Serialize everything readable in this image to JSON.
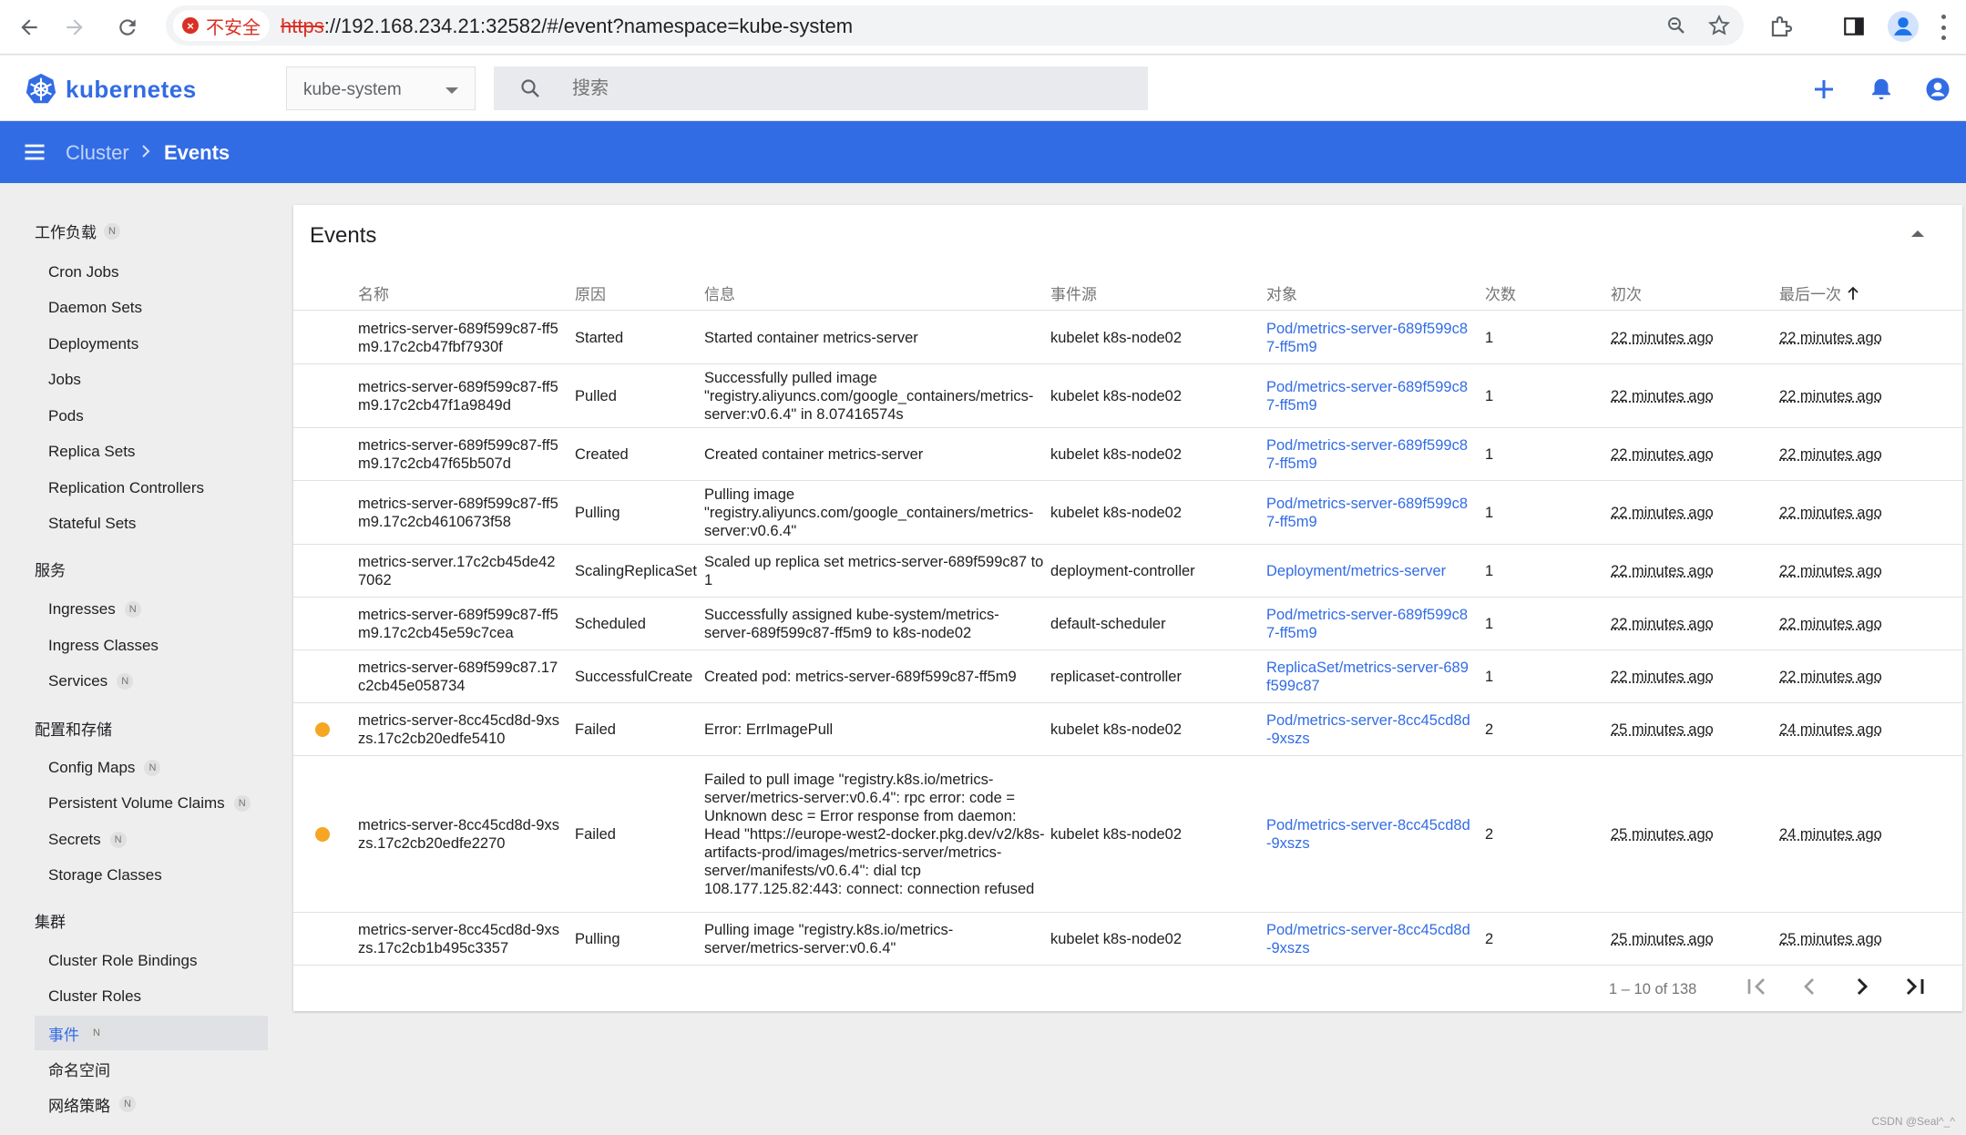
{
  "browser": {
    "security_label": "不安全",
    "url_protocol": "https",
    "url_rest": "://192.168.234.21:32582/#/event?namespace=kube-system"
  },
  "header": {
    "brand": "kubernetes",
    "namespace": "kube-system",
    "search_placeholder": "搜索"
  },
  "toolbar": {
    "crumb_parent": "Cluster",
    "crumb_current": "Events"
  },
  "sidebar": {
    "sections": [
      {
        "label": "工作负载",
        "badge": "N"
      },
      {
        "label": "服务"
      },
      {
        "label": "配置和存储"
      },
      {
        "label": "集群"
      }
    ],
    "items": [
      {
        "label": "Cron Jobs"
      },
      {
        "label": "Daemon Sets"
      },
      {
        "label": "Deployments"
      },
      {
        "label": "Jobs"
      },
      {
        "label": "Pods"
      },
      {
        "label": "Replica Sets"
      },
      {
        "label": "Replication Controllers"
      },
      {
        "label": "Stateful Sets"
      },
      {
        "label": "Ingresses",
        "badge": "N"
      },
      {
        "label": "Ingress Classes"
      },
      {
        "label": "Services",
        "badge": "N"
      },
      {
        "label": "Config Maps",
        "badge": "N"
      },
      {
        "label": "Persistent Volume Claims",
        "badge": "N"
      },
      {
        "label": "Secrets",
        "badge": "N"
      },
      {
        "label": "Storage Classes"
      },
      {
        "label": "Cluster Role Bindings"
      },
      {
        "label": "Cluster Roles"
      },
      {
        "label": "事件",
        "badge": "N",
        "active": true
      },
      {
        "label": "命名空间"
      },
      {
        "label": "网络策略",
        "badge": "N"
      }
    ]
  },
  "events": {
    "title": "Events",
    "columns": {
      "name": "名称",
      "reason": "原因",
      "message": "信息",
      "source": "事件源",
      "object": "对象",
      "count": "次数",
      "first": "初次",
      "last": "最后一次"
    },
    "rows": [
      {
        "name": "metrics-server-689f599c87-ff5m9.17c2cb47fbf7930f",
        "reason": "Started",
        "message": "Started container metrics-server",
        "source": "kubelet k8s-node02",
        "object": "Pod/metrics-server-689f599c87-ff5m9",
        "count": "1",
        "first": "22 minutes ago",
        "last": "22 minutes ago",
        "warning": false
      },
      {
        "name": "metrics-server-689f599c87-ff5m9.17c2cb47f1a9849d",
        "reason": "Pulled",
        "message": "Successfully pulled image \"registry.aliyuncs.com/google_containers/metrics-server:v0.6.4\" in 8.07416574s",
        "source": "kubelet k8s-node02",
        "object": "Pod/metrics-server-689f599c87-ff5m9",
        "count": "1",
        "first": "22 minutes ago",
        "last": "22 minutes ago",
        "warning": false
      },
      {
        "name": "metrics-server-689f599c87-ff5m9.17c2cb47f65b507d",
        "reason": "Created",
        "message": "Created container metrics-server",
        "source": "kubelet k8s-node02",
        "object": "Pod/metrics-server-689f599c87-ff5m9",
        "count": "1",
        "first": "22 minutes ago",
        "last": "22 minutes ago",
        "warning": false
      },
      {
        "name": "metrics-server-689f599c87-ff5m9.17c2cb4610673f58",
        "reason": "Pulling",
        "message": "Pulling image \"registry.aliyuncs.com/google_containers/metrics-server:v0.6.4\"",
        "source": "kubelet k8s-node02",
        "object": "Pod/metrics-server-689f599c87-ff5m9",
        "count": "1",
        "first": "22 minutes ago",
        "last": "22 minutes ago",
        "warning": false
      },
      {
        "name": "metrics-server.17c2cb45de427062",
        "reason": "ScalingReplicaSet",
        "message": "Scaled up replica set metrics-server-689f599c87 to 1",
        "source": "deployment-controller",
        "object": "Deployment/metrics-server",
        "count": "1",
        "first": "22 minutes ago",
        "last": "22 minutes ago",
        "warning": false
      },
      {
        "name": "metrics-server-689f599c87-ff5m9.17c2cb45e59c7cea",
        "reason": "Scheduled",
        "message": "Successfully assigned kube-system/metrics-server-689f599c87-ff5m9 to k8s-node02",
        "source": "default-scheduler",
        "object": "Pod/metrics-server-689f599c87-ff5m9",
        "count": "1",
        "first": "22 minutes ago",
        "last": "22 minutes ago",
        "warning": false
      },
      {
        "name": "metrics-server-689f599c87.17c2cb45e058734",
        "reason": "SuccessfulCreate",
        "message": "Created pod: metrics-server-689f599c87-ff5m9",
        "source": "replicaset-controller",
        "object": "ReplicaSet/metrics-server-689f599c87",
        "count": "1",
        "first": "22 minutes ago",
        "last": "22 minutes ago",
        "warning": false
      },
      {
        "name": "metrics-server-8cc45cd8d-9xszs.17c2cb20edfe5410",
        "reason": "Failed",
        "message": "Error: ErrImagePull",
        "source": "kubelet k8s-node02",
        "object": "Pod/metrics-server-8cc45cd8d-9xszs",
        "count": "2",
        "first": "25 minutes ago",
        "last": "24 minutes ago",
        "warning": true
      },
      {
        "name": "metrics-server-8cc45cd8d-9xszs.17c2cb20edfe2270",
        "reason": "Failed",
        "message": "Failed to pull image \"registry.k8s.io/metrics-server/metrics-server:v0.6.4\": rpc error: code = Unknown desc = Error response from daemon: Head \"https://europe-west2-docker.pkg.dev/v2/k8s-artifacts-prod/images/metrics-server/metrics-server/manifests/v0.6.4\": dial tcp 108.177.125.82:443: connect: connection refused",
        "source": "kubelet k8s-node02",
        "object": "Pod/metrics-server-8cc45cd8d-9xszs",
        "count": "2",
        "first": "25 minutes ago",
        "last": "24 minutes ago",
        "warning": true
      },
      {
        "name": "metrics-server-8cc45cd8d-9xszs.17c2cb1b495c3357",
        "reason": "Pulling",
        "message": "Pulling image \"registry.k8s.io/metrics-server/metrics-server:v0.6.4\"",
        "source": "kubelet k8s-node02",
        "object": "Pod/metrics-server-8cc45cd8d-9xszs",
        "count": "2",
        "first": "25 minutes ago",
        "last": "25 minutes ago",
        "warning": false
      }
    ],
    "pagination": "1 – 10 of 138"
  },
  "watermark": "CSDN @Seal^_^",
  "colors": {
    "brand": "#326ce5",
    "warning": "#f5a623",
    "insecure": "#d93025"
  }
}
